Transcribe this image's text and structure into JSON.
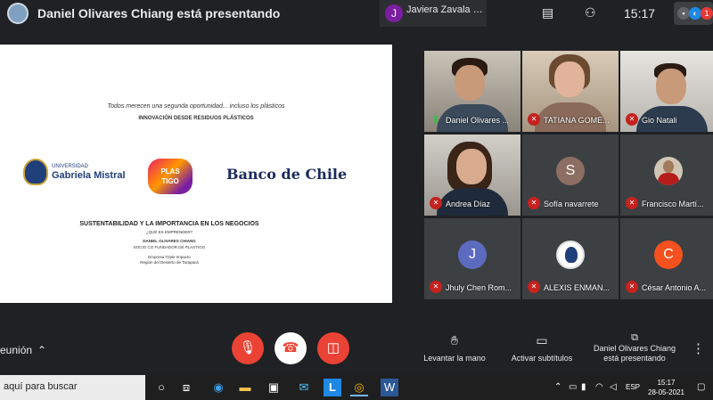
{
  "topbar": {
    "presenting_text": "Daniel Olivares Chiang está presentando",
    "top_tile_initial": "J",
    "top_tile_name": "Javiera Zavala C...",
    "clock": "15:17",
    "self_tile_badge": "1"
  },
  "slide": {
    "line1": "Todos merecen una segunda oportunidad... incluso los plásticos",
    "line2": "INNOVACIÓN DESDE RESIDUOS PLÁSTICOS",
    "logo_ugm_small": "UNIVERSIDAD",
    "logo_ugm_big": "Gabriela Mistral",
    "logo_plas_top": "PLAS",
    "logo_plas_bottom": "TIGO",
    "logo_bank": "Banco de Chile",
    "title": "SUSTENTABILIDAD Y LA IMPORTANCIA EN LOS NEGOCIOS",
    "question": "¿QUÉ ES EMPRENDER?",
    "speaker": "DANIEL OLIVARES CHIANG",
    "role": "SOCIO CO FUNDADOR DE PLASTIGO",
    "note1": "Empresa Triple Impacto",
    "note2": "Región del Desierto de Tarapacá"
  },
  "participants": [
    {
      "name": "Daniel Olivares ...",
      "mic": "on",
      "type": "video"
    },
    {
      "name": "TATIANA GOME...",
      "mic": "muted",
      "type": "video"
    },
    {
      "name": "Gio Natali",
      "mic": "muted",
      "type": "video"
    },
    {
      "name": "Andrea Díaz",
      "mic": "muted",
      "type": "video"
    },
    {
      "name": "Sofía navarrete",
      "mic": "muted",
      "type": "avatar",
      "initial": "S",
      "color": "#8d6e63"
    },
    {
      "name": "Francisco Martí...",
      "mic": "muted",
      "type": "photo"
    },
    {
      "name": "Jhuly Chen Rom...",
      "mic": "muted",
      "type": "avatar",
      "initial": "J",
      "color": "#5c6bc0"
    },
    {
      "name": "ALEXIS ENMAN...",
      "mic": "muted",
      "type": "logo"
    },
    {
      "name": "César Antonio A...",
      "mic": "muted",
      "type": "avatar",
      "initial": "C",
      "color": "#f4511e"
    }
  ],
  "bottombar": {
    "meeting_label": "eunión",
    "raise_hand": "Levantar la mano",
    "captions": "Activar subtítulos",
    "presenter_line1": "Daniel Olivares Chiang",
    "presenter_line2": "está presentando"
  },
  "taskbar": {
    "search_placeholder": "aquí para buscar",
    "language": "ESP",
    "time": "15:17",
    "date": "28-05-2021"
  },
  "colors": {
    "background": "#202124",
    "danger": "#ea4335",
    "tile": "#3c4043"
  }
}
